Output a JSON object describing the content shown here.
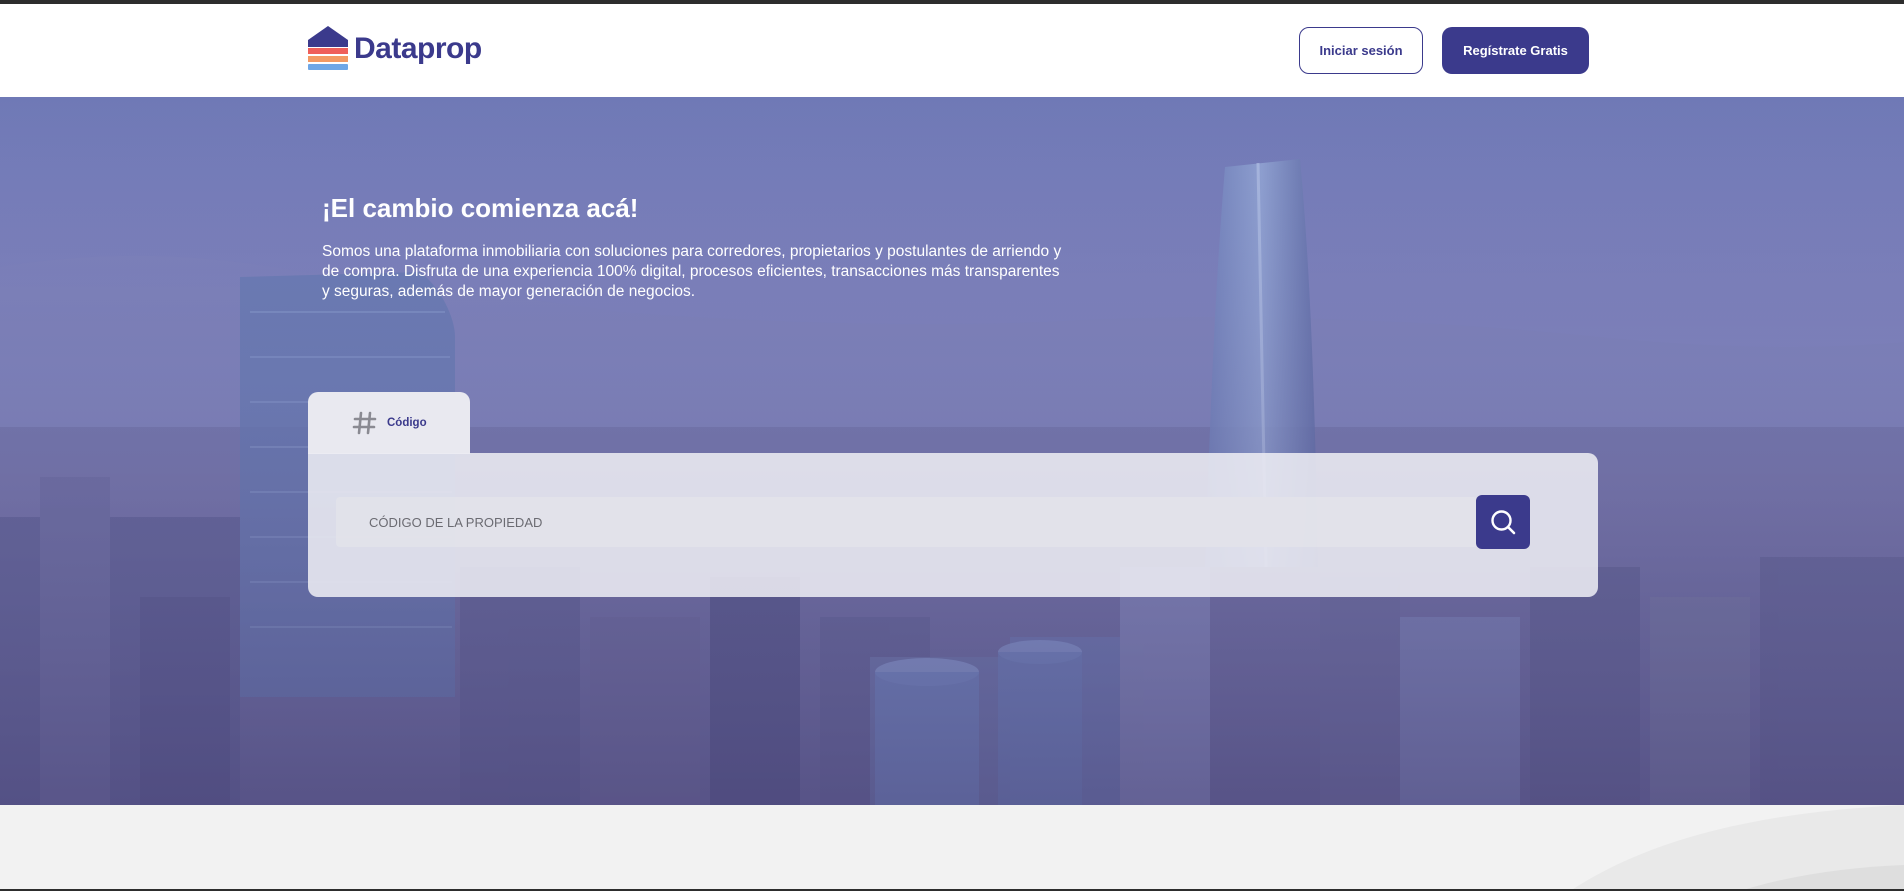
{
  "header": {
    "logo_text": "Dataprop",
    "login_label": "Iniciar sesión",
    "register_label": "Regístrate Gratis"
  },
  "hero": {
    "title": "¡El cambio comienza acá!",
    "description": "Somos una plataforma inmobiliaria con soluciones para corredores, propietarios y postulantes de arriendo y de compra. Disfruta de una experiencia 100% digital, procesos eficientes, transacciones más transparentes y seguras, además de mayor generación de negocios."
  },
  "search": {
    "tab_label": "Código",
    "placeholder": "CÓDIGO DE LA PROPIEDAD",
    "icon": "search-icon"
  },
  "colors": {
    "brand": "#3b3a8c",
    "logo_stripes": [
      "#ef5f5a",
      "#f39a63",
      "#6fa7e6"
    ]
  }
}
